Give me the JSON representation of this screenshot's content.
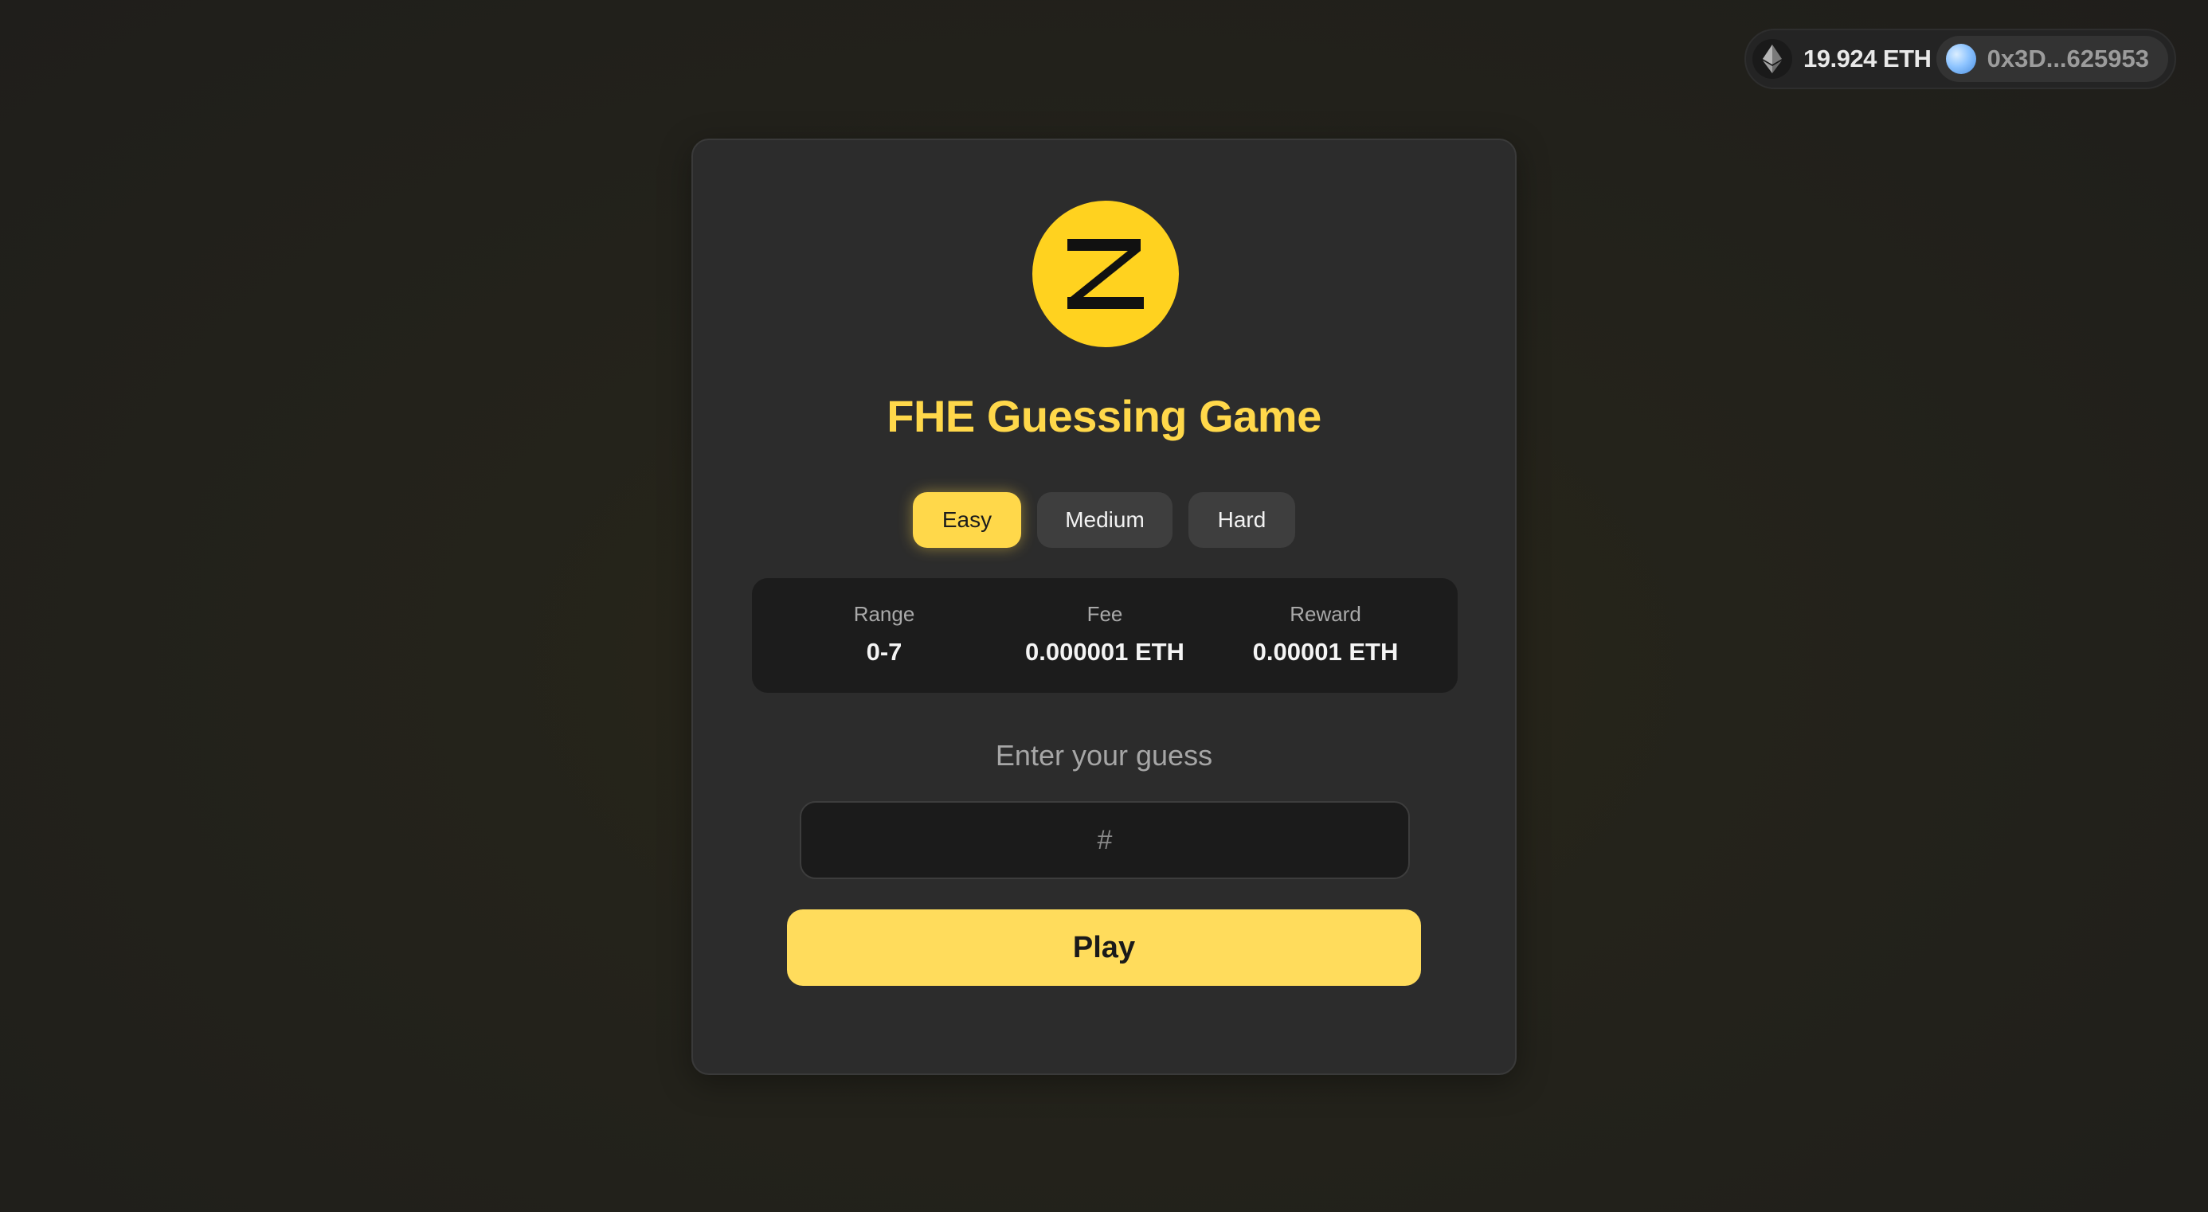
{
  "wallet": {
    "balance": "19.924 ETH",
    "address": "0x3D...625953"
  },
  "game": {
    "logo_letter": "Z",
    "title": "FHE Guessing Game",
    "difficulties": [
      "Easy",
      "Medium",
      "Hard"
    ],
    "selected_difficulty": "Easy",
    "stats": {
      "range_label": "Range",
      "range_value": "0-7",
      "fee_label": "Fee",
      "fee_value": "0.000001 ETH",
      "reward_label": "Reward",
      "reward_value": "0.00001 ETH"
    },
    "guess_label": "Enter your guess",
    "guess_placeholder": "#",
    "guess_value": "",
    "play_label": "Play"
  },
  "colors": {
    "accent": "#ffd84a",
    "logo": "#ffd21f",
    "card": "#2c2c2c",
    "background": "#23221c"
  },
  "icons": {
    "network": "ethereum-icon",
    "account": "account-avatar-icon"
  }
}
